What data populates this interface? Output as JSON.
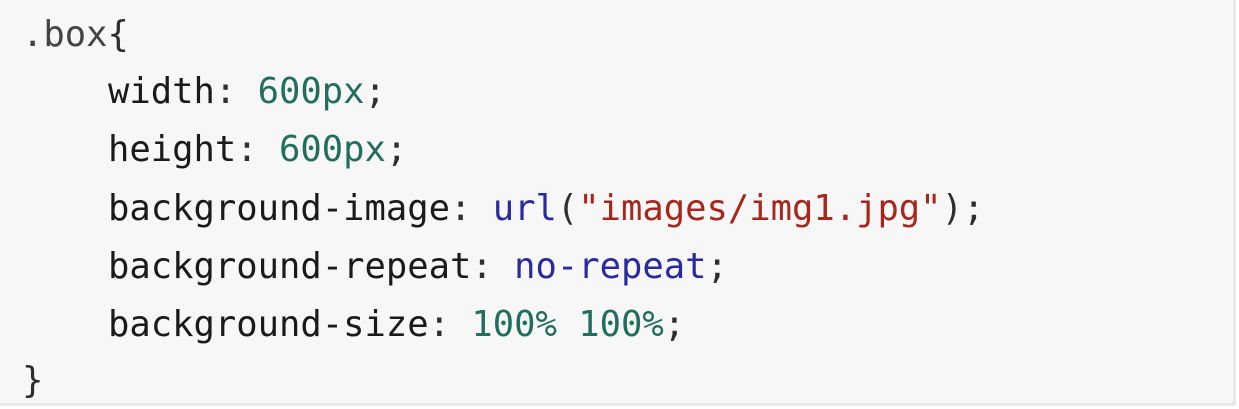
{
  "code": {
    "selector": ".box",
    "open_brace": "{",
    "close_brace": "}",
    "lines": [
      {
        "property": "width",
        "colon": ": ",
        "value": "600px",
        "semicolon": ";"
      },
      {
        "property": "height",
        "colon": ": ",
        "value": "600px",
        "semicolon": ";"
      },
      {
        "property": "background-image",
        "colon": ": ",
        "func": "url",
        "paren_open": "(",
        "string": "\"images/img1.jpg\"",
        "paren_close": ")",
        "semicolon": ";"
      },
      {
        "property": "background-repeat",
        "colon": ": ",
        "value": "no-repeat",
        "semicolon": ";"
      },
      {
        "property": "background-size",
        "colon": ": ",
        "value": "100% 100%",
        "semicolon": ";"
      }
    ]
  },
  "colors": {
    "background": "#f7f7f7",
    "property": "#1a1a1a",
    "number": "#216e5d",
    "function": "#2a2aa0",
    "string": "#a8261c",
    "keyword": "#2a2aa0"
  }
}
